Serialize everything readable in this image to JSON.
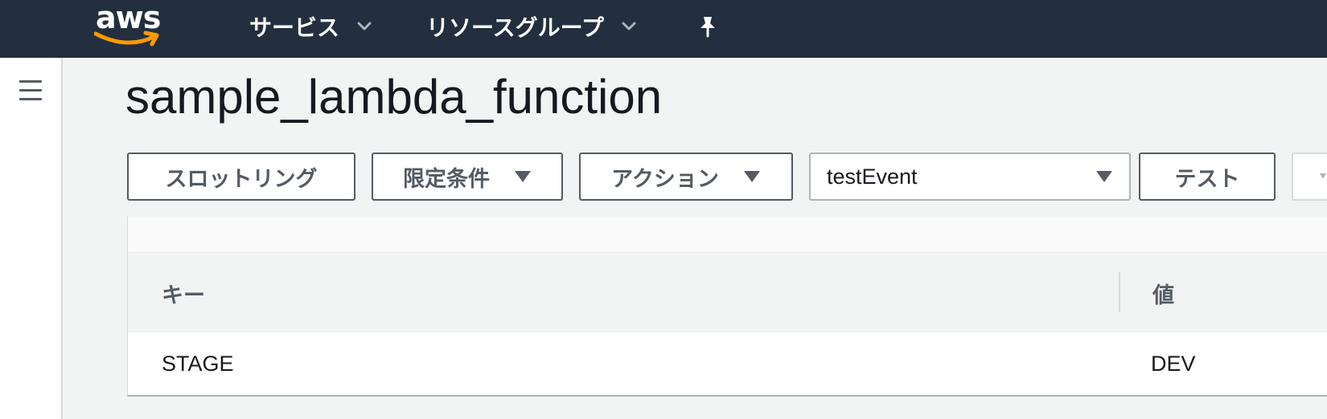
{
  "brand": {
    "logo_text": "aws",
    "accent_color": "#ff9900",
    "nav_bg": "#232f3e"
  },
  "nav": {
    "services_label": "サービス",
    "resource_groups_label": "リソースグループ",
    "caret_icon": "chevron-down-icon",
    "pin_icon": "pushpin-icon"
  },
  "sidebar": {
    "menu_icon": "hamburger-icon"
  },
  "page": {
    "title": "sample_lambda_function"
  },
  "toolbar": {
    "throttle_label": "スロットリング",
    "qualifiers_label": "限定条件",
    "actions_label": "アクション",
    "test_event_selected": "testEvent",
    "test_label": "テスト"
  },
  "env_vars": {
    "columns": {
      "key": "キー",
      "value": "値"
    },
    "rows": [
      {
        "key": "STAGE",
        "value": "DEV"
      }
    ]
  }
}
